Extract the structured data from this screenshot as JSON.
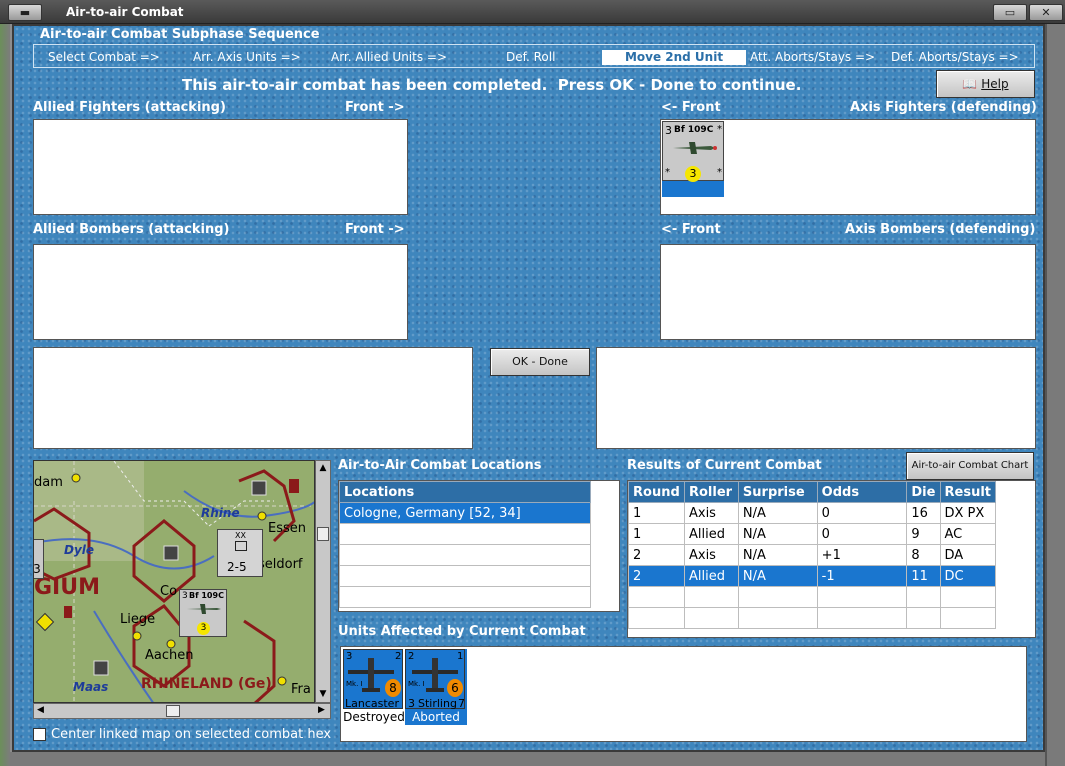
{
  "window": {
    "title": "Air-to-air Combat"
  },
  "sequence": {
    "title": "Air-to-air Combat Subphase Sequence",
    "steps": [
      "Select Combat =>",
      "Arr. Axis Units =>",
      "Arr. Allied Units =>",
      "Def. Roll",
      "Move 2nd Unit",
      "Att. Aborts/Stays =>",
      "Def. Aborts/Stays =>"
    ],
    "active_step": "Move 2nd Unit"
  },
  "status_message": "This air-to-air combat has been completed.  Press OK - Done to continue.",
  "help_label": "Help",
  "allied_fighters": {
    "label": "Allied Fighters (attacking)",
    "front": "Front ->"
  },
  "axis_fighters": {
    "label": "Axis Fighters (defending)",
    "front": "<- Front"
  },
  "allied_bombers": {
    "label": "Allied Bombers (attacking)",
    "front": "Front ->"
  },
  "axis_bombers": {
    "label": "Axis Bombers (defending)",
    "front": "<- Front"
  },
  "axis_fighter_unit": {
    "left": "3",
    "name": "Bf 109C",
    "star": "*",
    "value": "3"
  },
  "ok_done_label": "OK - Done",
  "combat_chart_label": "Air-to-air Combat Chart",
  "locations": {
    "title": "Air-to-Air Combat Locations",
    "header": "Locations",
    "rows": [
      "Cologne, Germany [52, 34]"
    ]
  },
  "results": {
    "title": "Results of Current Combat",
    "headers": [
      "Round",
      "Roller",
      "Surprise",
      "Odds",
      "Die",
      "Result"
    ],
    "rows": [
      [
        "1",
        "Axis",
        "N/A",
        "0",
        "16",
        "DX PX"
      ],
      [
        "1",
        "Allied",
        "N/A",
        "0",
        "9",
        "AC"
      ],
      [
        "2",
        "Axis",
        "N/A",
        "+1",
        "8",
        "DA"
      ],
      [
        "2",
        "Allied",
        "N/A",
        "-1",
        "11",
        "DC"
      ]
    ],
    "selected_row": 3
  },
  "units_affected": {
    "title": "Units Affected by Current Combat",
    "units": [
      {
        "name": "Lancaster",
        "mk": "Mk. I",
        "top_left": "3",
        "top_right": "2",
        "value": "8",
        "status": "Destroyed"
      },
      {
        "name": "Stirling",
        "mk": "Mk. I",
        "top_left": "2",
        "top_right": "1",
        "bottom_left": "3",
        "bottom_right": "7",
        "value": "6",
        "status": "Aborted"
      }
    ]
  },
  "map": {
    "labels": [
      "dam",
      "Rhine",
      "Essen",
      "Dyle",
      "seldorf",
      "GIUM",
      "Liege",
      "Co",
      "Aachen",
      "Maas",
      "RHINELAND (Ge)",
      "Fra",
      "3"
    ],
    "corps_counter": {
      "size": "XX",
      "value": "2-5"
    },
    "fighter_counter": {
      "left": "3",
      "name": "Bf 109C",
      "value": "3"
    }
  },
  "center_map_checkbox": {
    "label": "Center linked map on selected combat hex",
    "checked": false
  },
  "colors": {
    "panel_blue": "#3f86bd",
    "selection_blue": "#1a76cf",
    "header_blue": "#2d6ea6"
  }
}
